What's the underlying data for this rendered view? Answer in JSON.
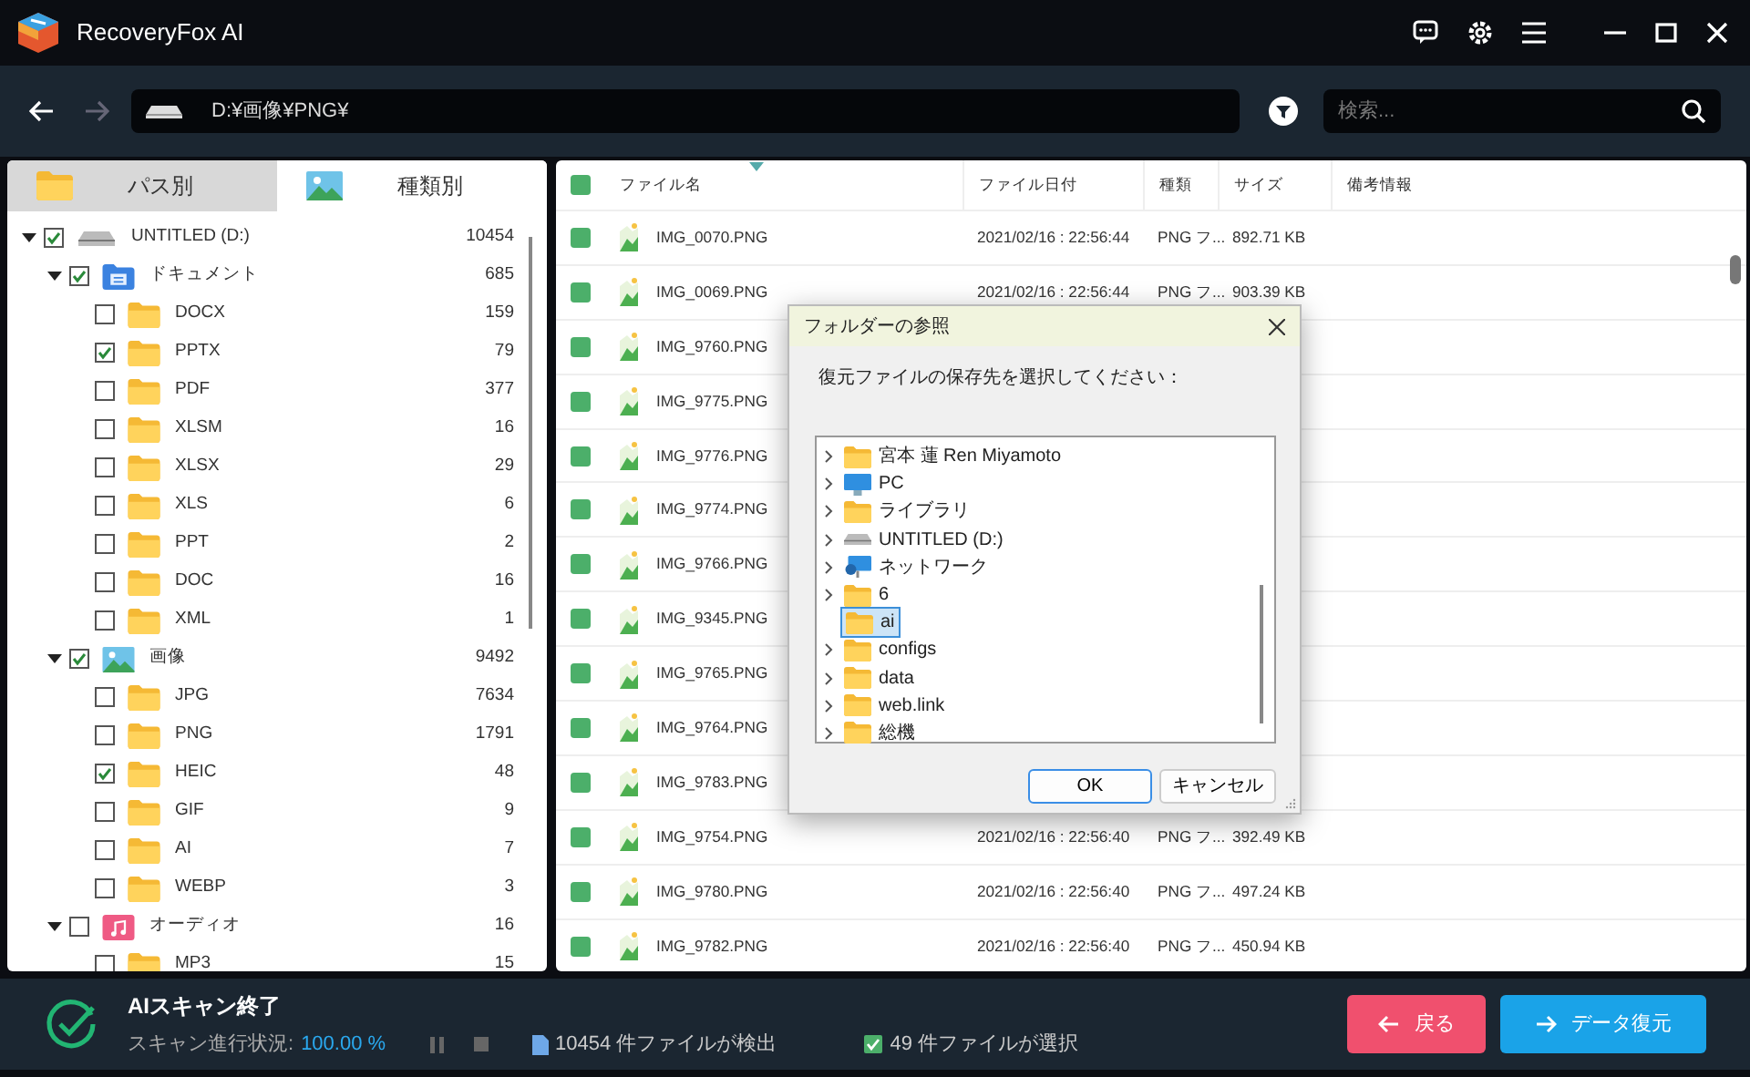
{
  "window": {
    "title": "RecoveryFox AI"
  },
  "toolbar": {
    "path": "D:¥画像¥PNG¥",
    "search": {
      "placeholder": "検索..."
    }
  },
  "view_tabs": [
    {
      "label": "パス別",
      "selected": true,
      "kind": "folder"
    },
    {
      "label": "種類別",
      "selected": false,
      "kind": "image"
    }
  ],
  "tree": [
    {
      "label": "UNTITLED (D:)",
      "count": "10454",
      "checked": true,
      "expanded": true,
      "kind": "drive",
      "children": [
        {
          "label": "ドキュメント",
          "count": "685",
          "checked": true,
          "expanded": true,
          "kind": "documents",
          "children": [
            {
              "label": "DOCX",
              "count": "159",
              "checked": false,
              "kind": "folder"
            },
            {
              "label": "PPTX",
              "count": "79",
              "checked": true,
              "kind": "folder"
            },
            {
              "label": "PDF",
              "count": "377",
              "checked": false,
              "kind": "folder"
            },
            {
              "label": "XLSM",
              "count": "16",
              "checked": false,
              "kind": "folder"
            },
            {
              "label": "XLSX",
              "count": "29",
              "checked": false,
              "kind": "folder"
            },
            {
              "label": "XLS",
              "count": "6",
              "checked": false,
              "kind": "folder"
            },
            {
              "label": "PPT",
              "count": "2",
              "checked": false,
              "kind": "folder"
            },
            {
              "label": "DOC",
              "count": "16",
              "checked": false,
              "kind": "folder"
            },
            {
              "label": "XML",
              "count": "1",
              "checked": false,
              "kind": "folder"
            }
          ]
        },
        {
          "label": "画像",
          "count": "9492",
          "checked": true,
          "expanded": true,
          "kind": "images",
          "children": [
            {
              "label": "JPG",
              "count": "7634",
              "checked": false,
              "kind": "folder"
            },
            {
              "label": "PNG",
              "count": "1791",
              "checked": false,
              "kind": "folder"
            },
            {
              "label": "HEIC",
              "count": "48",
              "checked": true,
              "kind": "folder"
            },
            {
              "label": "GIF",
              "count": "9",
              "checked": false,
              "kind": "folder"
            },
            {
              "label": "AI",
              "count": "7",
              "checked": false,
              "kind": "folder"
            },
            {
              "label": "WEBP",
              "count": "3",
              "checked": false,
              "kind": "folder"
            }
          ]
        },
        {
          "label": "オーディオ",
          "count": "16",
          "checked": false,
          "expanded": true,
          "kind": "audio",
          "children": [
            {
              "label": "MP3",
              "count": "15",
              "checked": false,
              "kind": "folder"
            }
          ]
        }
      ]
    }
  ],
  "table": {
    "all_checked": true,
    "columns": [
      "ファイル名",
      "ファイル日付",
      "種類",
      "サイズ",
      "備考情報"
    ],
    "rows": [
      {
        "name": "IMG_0070.PNG",
        "date": "2021/02/16 : 22:56:44",
        "type": "PNG フ...",
        "size": "892.71 KB",
        "checked": true
      },
      {
        "name": "IMG_0069.PNG",
        "date": "2021/02/16 : 22:56:44",
        "type": "PNG フ...",
        "size": "903.39 KB",
        "checked": true
      },
      {
        "name": "IMG_9760.PNG",
        "checked": true
      },
      {
        "name": "IMG_9775.PNG",
        "checked": true
      },
      {
        "name": "IMG_9776.PNG",
        "checked": true
      },
      {
        "name": "IMG_9774.PNG",
        "checked": true
      },
      {
        "name": "IMG_9766.PNG",
        "checked": true
      },
      {
        "name": "IMG_9345.PNG",
        "checked": true
      },
      {
        "name": "IMG_9765.PNG",
        "checked": true
      },
      {
        "name": "IMG_9764.PNG",
        "checked": true
      },
      {
        "name": "IMG_9783.PNG",
        "checked": true
      },
      {
        "name": "IMG_9754.PNG",
        "date": "2021/02/16 : 22:56:40",
        "type": "PNG フ...",
        "size": "392.49 KB",
        "checked": true
      },
      {
        "name": "IMG_9780.PNG",
        "date": "2021/02/16 : 22:56:40",
        "type": "PNG フ...",
        "size": "497.24 KB",
        "checked": true
      },
      {
        "name": "IMG_9782.PNG",
        "date": "2021/02/16 : 22:56:40",
        "type": "PNG フ...",
        "size": "450.94 KB",
        "checked": true
      }
    ]
  },
  "dialog": {
    "title": "フォルダーの参照",
    "prompt": "復元ファイルの保存先を選択してください：",
    "items": [
      {
        "label": "宮本 蓮 Ren Miyamoto",
        "kind": "folder",
        "expandable": true,
        "selected": false
      },
      {
        "label": "PC",
        "kind": "pc",
        "expandable": true,
        "selected": false
      },
      {
        "label": "ライブラリ",
        "kind": "folder",
        "expandable": true,
        "selected": false
      },
      {
        "label": "UNTITLED (D:)",
        "kind": "drive",
        "expandable": true,
        "selected": false
      },
      {
        "label": "ネットワーク",
        "kind": "network",
        "expandable": true,
        "selected": false
      },
      {
        "label": "6",
        "kind": "folder",
        "expandable": true,
        "selected": false
      },
      {
        "label": "ai",
        "kind": "folder",
        "expandable": false,
        "selected": true
      },
      {
        "label": "configs",
        "kind": "folder",
        "expandable": true,
        "selected": false
      },
      {
        "label": "data",
        "kind": "folder",
        "expandable": true,
        "selected": false
      },
      {
        "label": "web.link",
        "kind": "folder",
        "expandable": true,
        "selected": false
      },
      {
        "label": "総機",
        "kind": "folder",
        "expandable": true,
        "selected": false
      }
    ],
    "buttons": [
      {
        "label": "OK",
        "default": true
      },
      {
        "label": "キャンセル",
        "default": false
      }
    ]
  },
  "status": {
    "title": "AIスキャン終了",
    "progress_label": "スキャン進行状況:",
    "progress_value": "100.00 %",
    "found": "10454 件ファイルが検出",
    "selected_count": "49 件ファイルが選択",
    "buttons": [
      {
        "label": "戻る",
        "kind": "back"
      },
      {
        "label": "データ復元",
        "kind": "restore"
      }
    ]
  }
}
